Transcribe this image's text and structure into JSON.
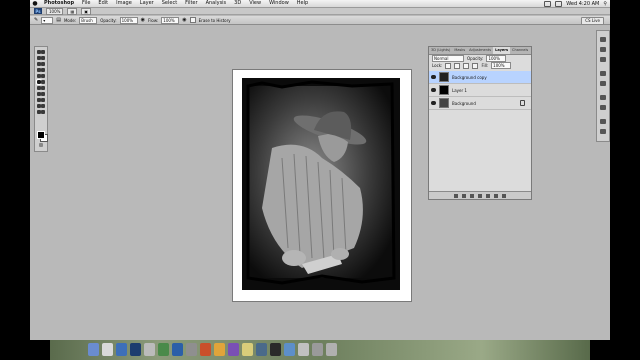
{
  "menubar": {
    "apple": "",
    "items": [
      "Photoshop",
      "File",
      "Edit",
      "Image",
      "Layer",
      "Select",
      "Filter",
      "Analysis",
      "3D",
      "View",
      "Window",
      "Help"
    ],
    "clock": "Wed 4:20 AM"
  },
  "appbar": {
    "ps_logo": "Ps",
    "zoom": "100%"
  },
  "options": {
    "mode_label": "Mode:",
    "mode_value": "Brush",
    "opacity_label": "Opacity:",
    "opacity_value": "100%",
    "flow_label": "Flow:",
    "flow_value": "100%",
    "erase_label": "Erase to History",
    "workspace": "CS Live"
  },
  "layers_panel": {
    "tabs": [
      "3D (Lights)",
      "Masks",
      "Adjustments",
      "Layers",
      "Channels"
    ],
    "active_tab": "Layers",
    "blend_mode": "Normal",
    "opacity_label": "Opacity:",
    "opacity_value": "100%",
    "lock_label": "Lock:",
    "fill_label": "Fill:",
    "fill_value": "100%",
    "layers": [
      {
        "name": "Background copy",
        "selected": true
      },
      {
        "name": "Layer 1",
        "selected": false
      },
      {
        "name": "Background",
        "selected": false,
        "locked": true
      }
    ]
  },
  "colors": {
    "canvas_bg": "#b9b9b9",
    "selection": "#b8d3ff",
    "foreground": "#000000",
    "background": "#ffffff"
  }
}
